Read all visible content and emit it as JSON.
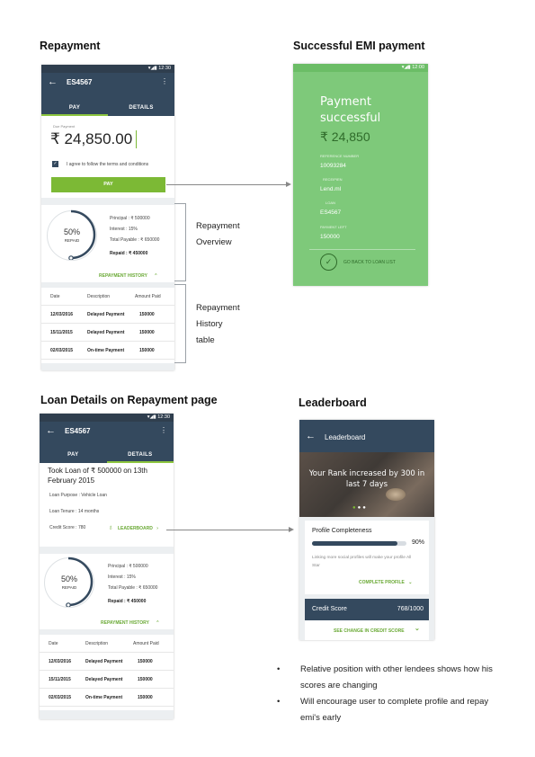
{
  "sections": {
    "repayment": "Repayment",
    "success": "Successful EMI payment",
    "loan_details": "Loan Details on Repayment page",
    "leaderboard": "Leaderboard"
  },
  "status_time": "12:30",
  "repay_screen": {
    "loan_id": "ES4567",
    "tabs": [
      "PAY",
      "DETAILS"
    ],
    "due_label": "Due Payment",
    "due_amount": "₹ 24,850.00",
    "terms": "I agree to follow the terms and conditions",
    "pay_button": "PAY"
  },
  "overview": {
    "percent": "50%",
    "percent_label": "REPAID",
    "principal": "Principal : ₹ 500000",
    "interest": "Interest : 15%",
    "total": "Total Payable : ₹ 650000",
    "repaid": "Repaid : ₹ 450000",
    "history_link": "REPAYMENT HISTORY"
  },
  "history": {
    "headers": [
      "Date",
      "Description",
      "Amount Paid"
    ],
    "rows": [
      [
        "12/03/2016",
        "Delayed Payment",
        "150000"
      ],
      [
        "15/11/2015",
        "Delayed Payment",
        "150000"
      ],
      [
        "02/03/2015",
        "On-time Payment",
        "150000"
      ]
    ]
  },
  "success_screen": {
    "time": "12:00",
    "heading_line1": "Payment",
    "heading_line2": "successful",
    "amount": "₹ 24,850",
    "ref_label": "REFERENCE NUMBER",
    "ref_value": "10093284",
    "recipient_label": "RECEIPIEN",
    "recipient_value": "Lend.ml",
    "loan_label": "LOAN",
    "loan_value": "ES4567",
    "left_label": "PAYMENT LEFT",
    "left_value": "150000",
    "back_link": "GO BACK TO LOAN LIST"
  },
  "annotations": {
    "overview_line1": "Repayment",
    "overview_line2": "Overview",
    "history_line1": "Repayment",
    "history_line2": "History",
    "history_line3": "table"
  },
  "details_screen": {
    "loan_id": "ES4567",
    "tabs": [
      "PAY",
      "DETAILS"
    ],
    "title": "Took Loan of ₹ 500000 on 13th February 2015",
    "purpose": "Loan Purpose : Vehicle Loan",
    "tenure": "Loan Tenure : 14 months",
    "credit": "Credit Score : 780",
    "leaderboard_link": "LEADERBOARD"
  },
  "leaderboard_screen": {
    "title": "Leaderboard",
    "banner_text": "Your Rank increased by 300 in last 7 days",
    "profile_title": "Profile Completeness",
    "profile_percent": "90%",
    "profile_progress": 0.9,
    "profile_hint": "Linking more social profiles will make your profile All Star",
    "complete_link": "COMPLETE PROFILE",
    "credit_label": "Credit Score",
    "credit_value": "768/1000",
    "change_link": "SEE CHANGE IN CREDIT SCORE"
  },
  "bullets": [
    "Relative position with other lendees shows how his scores are changing",
    "Will encourage user to complete profile and repay emi's early"
  ],
  "colors": {
    "appbar": "#34495e",
    "accent_green": "#7cb935",
    "success_bg": "#7ec97a"
  }
}
